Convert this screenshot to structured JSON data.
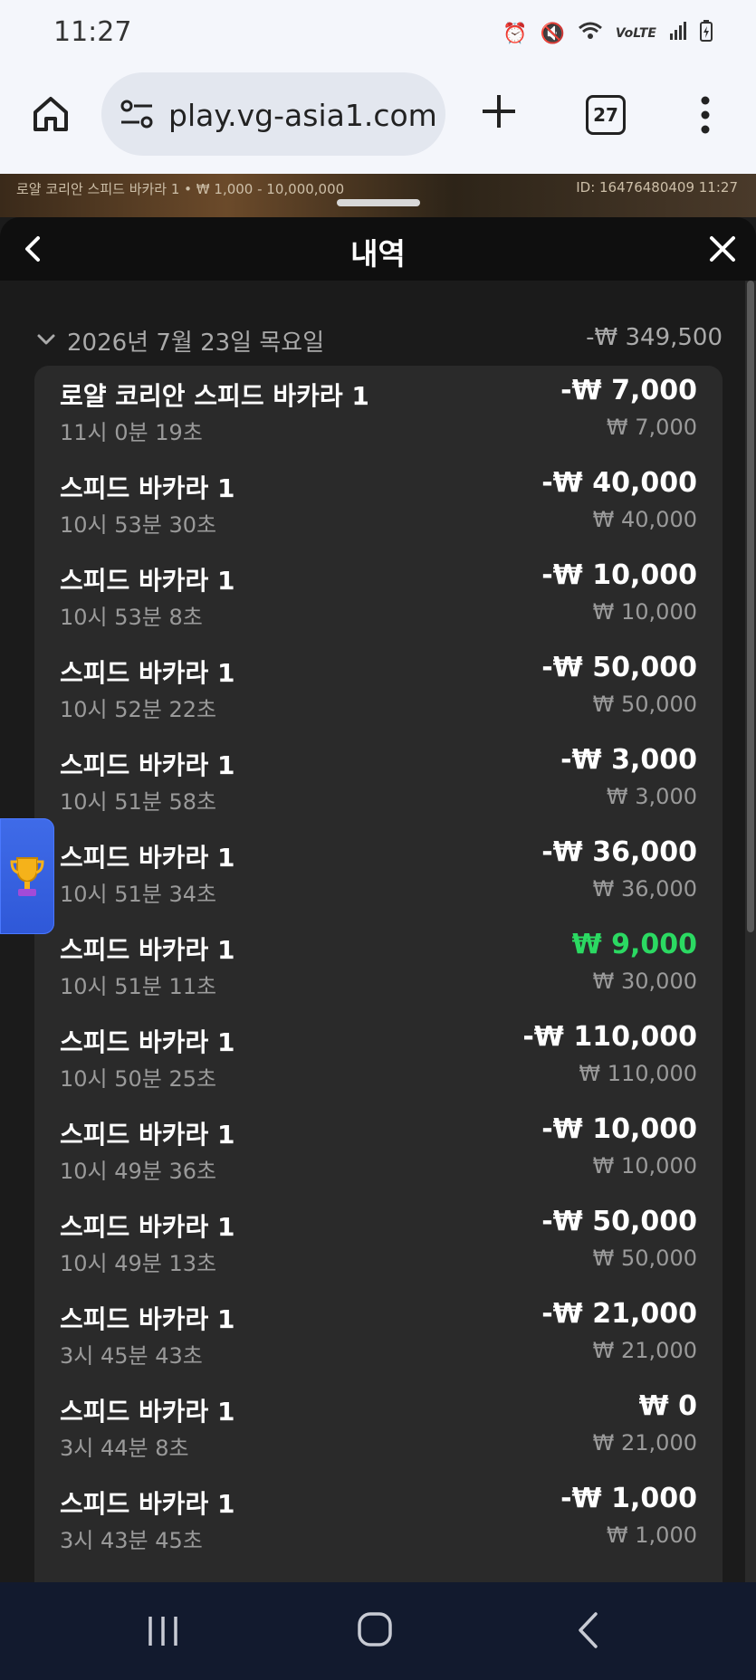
{
  "status_bar": {
    "time": "11:27",
    "icons": [
      "alarm-icon",
      "mute-icon",
      "wifi-icon",
      "volte-icon",
      "signal-icon",
      "battery-icon"
    ]
  },
  "browser": {
    "url": "play.vg-asia1.com",
    "tab_count": "27"
  },
  "game": {
    "info": "로얄 코리안 스피드 바카라 1 • ₩ 1,000 - 10,000,000",
    "id_label": "ID: 16476480409 11:27"
  },
  "panel": {
    "title": "내역",
    "date": "2026년 7월 23일 목요일",
    "total": "-₩ 349,500"
  },
  "items": [
    {
      "name": "로얄 코리안 스피드 바카라 1",
      "time": "11시 0분 19초",
      "result": "-₩ 7,000",
      "bet": "₩ 7,000"
    },
    {
      "name": "스피드 바카라 1",
      "time": "10시 53분 30초",
      "result": "-₩ 40,000",
      "bet": "₩ 40,000"
    },
    {
      "name": "스피드 바카라 1",
      "time": "10시 53분 8초",
      "result": "-₩ 10,000",
      "bet": "₩ 10,000"
    },
    {
      "name": "스피드 바카라 1",
      "time": "10시 52분 22초",
      "result": "-₩ 50,000",
      "bet": "₩ 50,000"
    },
    {
      "name": "스피드 바카라 1",
      "time": "10시 51분 58초",
      "result": "-₩ 3,000",
      "bet": "₩ 3,000"
    },
    {
      "name": "스피드 바카라 1",
      "time": "10시 51분 34초",
      "result": "-₩ 36,000",
      "bet": "₩ 36,000"
    },
    {
      "name": "스피드 바카라 1",
      "time": "10시 51분 11초",
      "result": "₩ 9,000",
      "bet": "₩ 30,000",
      "win": true
    },
    {
      "name": "스피드 바카라 1",
      "time": "10시 50분 25초",
      "result": "-₩ 110,000",
      "bet": "₩ 110,000"
    },
    {
      "name": "스피드 바카라 1",
      "time": "10시 49분 36초",
      "result": "-₩ 10,000",
      "bet": "₩ 10,000"
    },
    {
      "name": "스피드 바카라 1",
      "time": "10시 49분 13초",
      "result": "-₩ 50,000",
      "bet": "₩ 50,000"
    },
    {
      "name": "스피드 바카라 1",
      "time": "3시 45분 43초",
      "result": "-₩ 21,000",
      "bet": "₩ 21,000"
    },
    {
      "name": "스피드 바카라 1",
      "time": "3시 44분 8초",
      "result": "₩ 0",
      "bet": "₩ 21,000"
    },
    {
      "name": "스피드 바카라 1",
      "time": "3시 43분 45초",
      "result": "-₩ 1,000",
      "bet": "₩ 1,000"
    }
  ],
  "colors": {
    "win": "#2bd962",
    "panel_bg": "#1b1b1b",
    "card_bg": "#2a2a2a",
    "nav_bg": "#121a2e"
  }
}
